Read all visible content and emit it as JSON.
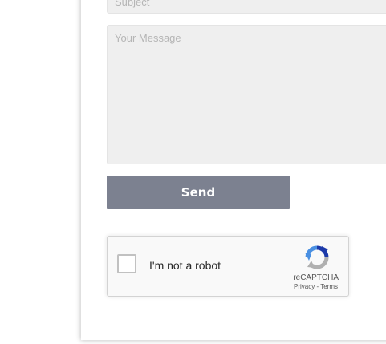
{
  "form": {
    "subject_placeholder": "Subject",
    "message_placeholder": "Your Message",
    "send_label": "Send"
  },
  "recaptcha": {
    "label": "I'm not a robot",
    "brand": "reCAPTCHA",
    "privacy": "Privacy",
    "separator": " - ",
    "terms": "Terms",
    "checked": false
  },
  "colors": {
    "button_bg": "#7c8190",
    "field_bg": "#efefef",
    "logo_blue": "#1c3aa9",
    "logo_light_blue": "#4a90e2",
    "logo_gray": "#b0b0b0"
  }
}
